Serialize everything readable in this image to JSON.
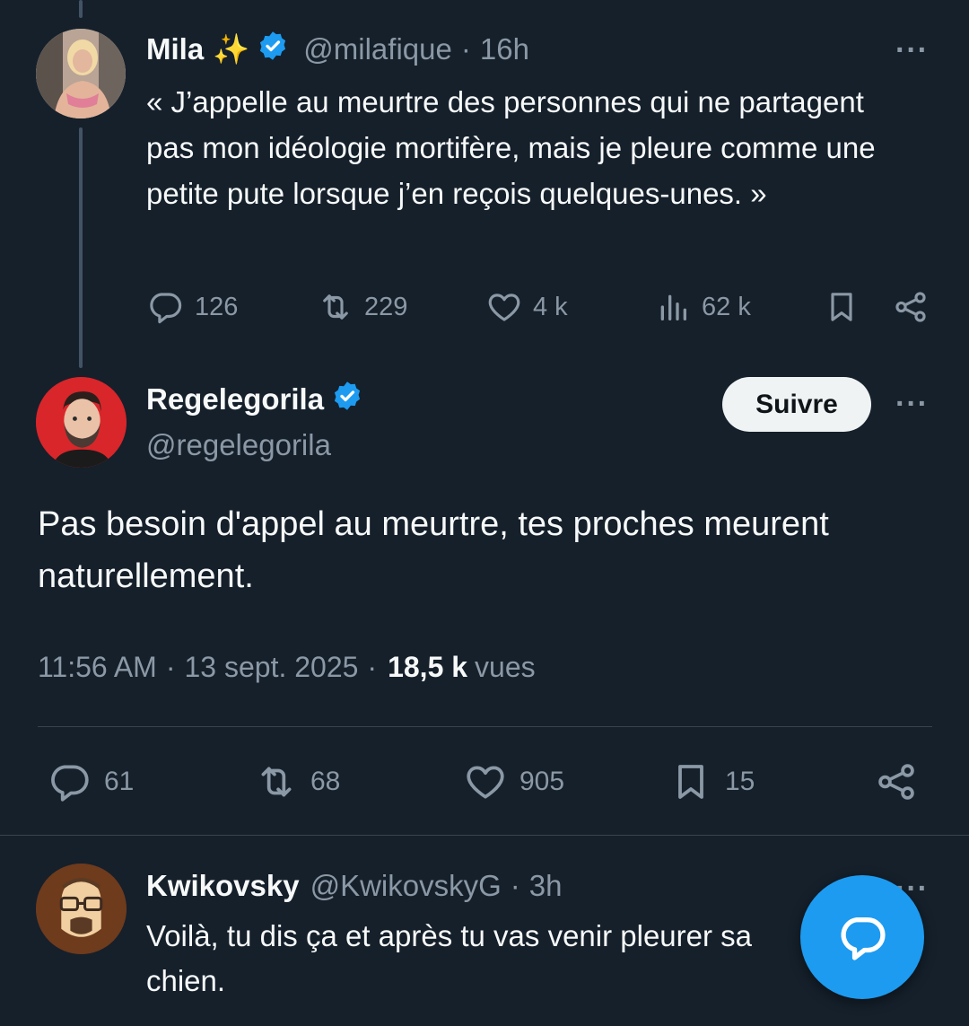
{
  "tweet_parent": {
    "name": "Mila",
    "emoji": "✨",
    "handle": "@milafique",
    "separator": "·",
    "time": "16h",
    "text": "« J’appelle au meurtre des personnes qui ne partagent pas mon idéologie mortifère, mais je pleure comme une petite pute lorsque j’en reçois quelques-unes. »",
    "replies": "126",
    "retweets": "229",
    "likes": "4 k",
    "views": "62 k"
  },
  "tweet_main": {
    "name": "Regelegorila",
    "handle": "@regelegorila",
    "follow_label": "Suivre",
    "text": "Pas besoin d'appel au meurtre, tes proches meurent naturellement.",
    "time": "11:56 AM",
    "sep1": "·",
    "date": "13 sept. 2025",
    "sep2": "·",
    "views_count": "18,5 k",
    "views_label": "vues",
    "replies": "61",
    "retweets": "68",
    "likes": "905",
    "bookmarks": "15"
  },
  "tweet_reply": {
    "name": "Kwikovsky",
    "handle": "@KwikovskyG",
    "separator": "·",
    "time": "3h",
    "text": "Voilà, tu dis ça et après tu vas venir pleurer sa chien."
  },
  "colors": {
    "background": "#15202b",
    "accent": "#1d9bf0",
    "muted": "#8b98a5",
    "divider": "#38444d"
  },
  "icons": [
    "reply-icon",
    "retweet-icon",
    "like-icon",
    "views-icon",
    "bookmark-icon",
    "share-icon",
    "more-icon",
    "verified-icon",
    "compose-reply-icon"
  ]
}
